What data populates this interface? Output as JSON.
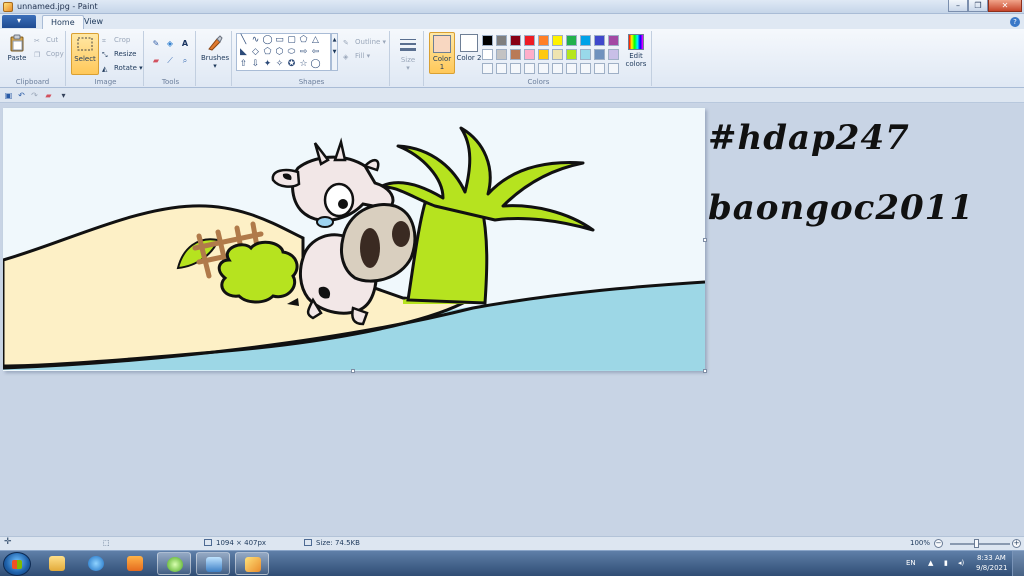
{
  "window": {
    "title": "unnamed.jpg - Paint",
    "minimize": "–",
    "maximize": "❐",
    "close": "✕"
  },
  "tabs": {
    "menu": "▾",
    "home": "Home",
    "view": "View",
    "help": "?"
  },
  "clipboard": {
    "paste": "Paste",
    "cut": "Cut",
    "copy": "Copy",
    "label": "Clipboard"
  },
  "image": {
    "select": "Select",
    "crop": "Crop",
    "resize": "Resize",
    "rotate": "Rotate",
    "label": "Image"
  },
  "tools": {
    "text_tool": "A",
    "label": "Tools"
  },
  "brushes": {
    "label": "Brushes"
  },
  "shapes": {
    "outline": "Outline",
    "fill": "Fill",
    "label": "Shapes",
    "glyphs": [
      "╲",
      "∿",
      "◯",
      "▭",
      "▢",
      "⬠",
      "△",
      "◣",
      "◇",
      "⬠",
      "⬡",
      "⬭",
      "⇨",
      "⇦",
      "⇧",
      "⇩",
      "✦",
      "✧",
      "✪",
      "☆",
      "▱",
      "◯",
      "☁",
      "♡"
    ]
  },
  "size": {
    "label": "Size"
  },
  "colors": {
    "color1": "Color 1",
    "color2": "Color 2",
    "edit": "Edit colors",
    "label": "Colors",
    "color1_value": "#f8d7c1",
    "color2_value": "#ffffff",
    "palette": [
      "#000000",
      "#7f7f7f",
      "#880015",
      "#ed1c24",
      "#ff7f27",
      "#fff200",
      "#22b14c",
      "#00a2e8",
      "#3f48cc",
      "#a349a4",
      "#ffffff",
      "#c3c3c3",
      "#b97a57",
      "#ffaec9",
      "#ffc90e",
      "#efe4b0",
      "#b5e61d",
      "#99d9ea",
      "#7092be",
      "#c8bfe7"
    ]
  },
  "canvas": {
    "handwritten_tag": "#hdap247",
    "handwritten_name": "baongoc2011"
  },
  "status": {
    "dimensions": "1094 × 407px",
    "size": "Size: 74.5KB",
    "zoom": "100%",
    "zoom_out": "−",
    "zoom_in": "+"
  },
  "tray": {
    "language": "EN",
    "time": "8:33 AM",
    "date": "9/8/2021"
  }
}
